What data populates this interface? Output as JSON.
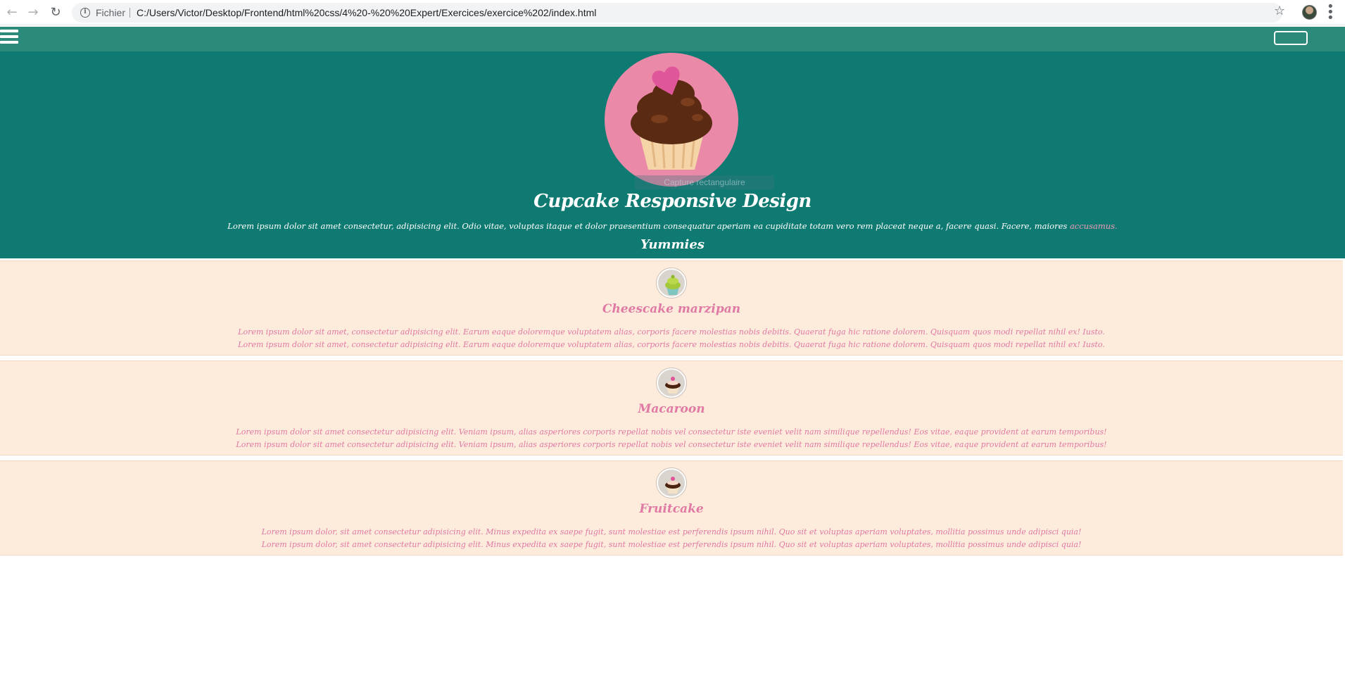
{
  "browser": {
    "back_icon": "back-arrow-icon",
    "forward_icon": "forward-arrow-icon",
    "reload_icon": "reload-icon",
    "security_label": "Fichier",
    "url": "C:/Users/Victor/Desktop/Frontend/html%20css/4%20-%20%20Expert/Exercices/exercice%202/index.html",
    "star_icon": "bookmark-star-icon",
    "menu_icon": "kebab-menu-icon"
  },
  "navbar": {
    "background": "#2c8a7a",
    "menu_icon": "hamburger-icon"
  },
  "hero": {
    "background": "#0f7a71",
    "overlay_text": "Capture rectangulaire",
    "title": "Cupcake Responsive Design",
    "text": "Lorem ipsum dolor sit amet consectetur, adipisicing elit. Odio vitae, voluptas itaque et dolor praesentium consequatur aperiam ea cupiditate totam vero rem placeat neque a, facere quasi. Facere, maiores",
    "link_text": "accusamus.",
    "link_color": "#f19bb8",
    "subtitle": "Yummies"
  },
  "cards": [
    {
      "title": "Cheescake marzipan",
      "line1": "Lorem ipsum dolor sit amet, consectetur adipisicing elit. Earum eaque doloremque voluptatem alias, corporis facere molestias nobis debitis. Quaerat fuga hic ratione dolorem. Quisquam quos modi repellat nihil ex! Iusto.",
      "line2": "Lorem ipsum dolor sit amet, consectetur adipisicing elit. Earum eaque doloremque voluptatem alias, corporis facere molestias nobis debitis. Quaerat fuga hic ratione dolorem. Quisquam quos modi repellat nihil ex! Iusto.",
      "icon": "green-cupcake-icon"
    },
    {
      "title": "Macaroon",
      "line1": "Lorem ipsum dolor sit amet consectetur adipisicing elit. Veniam ipsum, alias asperiores corporis repellat nobis vel consectetur iste eveniet velit nam similique repellendus! Eos vitae, eaque provident at earum temporibus!",
      "line2": "Lorem ipsum dolor sit amet consectetur adipisicing elit. Veniam ipsum, alias asperiores corporis repellat nobis vel consectetur iste eveniet velit nam similique repellendus! Eos vitae, eaque provident at earum temporibus!",
      "icon": "chocolate-cupcake-icon"
    },
    {
      "title": "Fruitcake",
      "line1": "Lorem ipsum dolor, sit amet consectetur adipisicing elit. Minus expedita ex saepe fugit, sunt molestiae est perferendis ipsum nihil. Quo sit et voluptas aperiam voluptates, mollitia possimus unde adipisci quia!",
      "line2": "Lorem ipsum dolor, sit amet consectetur adipisicing elit. Minus expedita ex saepe fugit, sunt molestiae est perferendis ipsum nihil. Quo sit et voluptas aperiam voluptates, mollitia possimus unde adipisci quia!",
      "icon": "chocolate-cupcake-icon"
    }
  ],
  "colors": {
    "card_background": "#fdebdc",
    "card_text": "#e07aa4",
    "logo_background": "#eb89a8"
  }
}
